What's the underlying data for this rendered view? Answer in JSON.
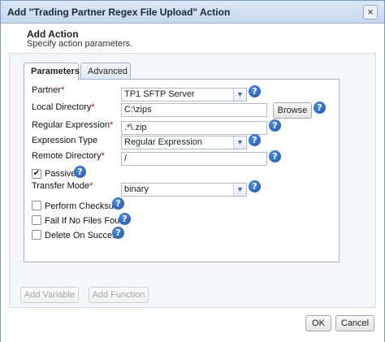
{
  "window": {
    "title": "Add \"Trading Partner Regex File Upload\" Action",
    "close_glyph": "×"
  },
  "header": {
    "title": "Add Action",
    "subtitle": "Specify action parameters."
  },
  "tabs": [
    {
      "label": "Parameters",
      "active": true
    },
    {
      "label": "Advanced",
      "active": false
    }
  ],
  "form": {
    "partner": {
      "label": "Partner",
      "required_mark": "*",
      "value": "TP1 SFTP Server"
    },
    "local_directory": {
      "label": "Local Directory",
      "required_mark": "*",
      "value": "C:\\zips",
      "browse_label": "Browse"
    },
    "regular_expression": {
      "label": "Regular Expression",
      "required_mark": "*",
      "value": ".*\\.zip"
    },
    "expression_type": {
      "label": "Expression Type",
      "value": "Regular Expression"
    },
    "remote_directory": {
      "label": "Remote Directory",
      "required_mark": "*",
      "value": "/"
    },
    "passive": {
      "label": "Passive",
      "checked": true
    },
    "transfer_mode": {
      "label": "Transfer Mode",
      "required_mark": "*",
      "value": "binary"
    },
    "perform_checksum": {
      "label": "Perform Checksum",
      "checked": false
    },
    "fail_if_no_files": {
      "label": "Fail If No Files Found",
      "checked": false
    },
    "delete_on_success": {
      "label": "Delete On Success",
      "checked": false
    }
  },
  "help_glyph": "?",
  "check_glyph": "✔",
  "dropdown_glyph": "▼",
  "footer": {
    "add_variable": "Add Variable",
    "add_function": "Add Function",
    "ok": "OK",
    "cancel": "Cancel"
  }
}
